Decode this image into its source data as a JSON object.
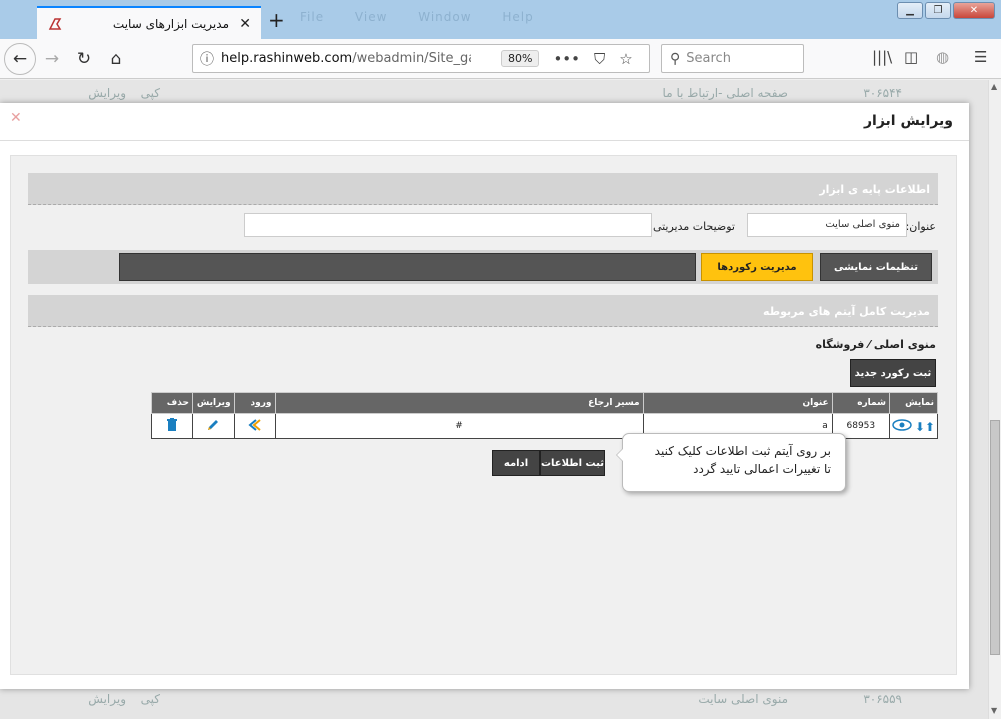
{
  "browser": {
    "tab_title": "مدیریت ابزارهای سایت",
    "tab_close": "✕",
    "new_tab": "+",
    "menu_ghost": [
      "File",
      "View",
      "Window",
      "Help"
    ],
    "url_host": "help.rashinweb.com",
    "url_path": "/webadmin/Site_gad",
    "zoom": "80%",
    "search_placeholder": "Search",
    "window_buttons": [
      "▁",
      "❐",
      "✕"
    ]
  },
  "background_rows": [
    {
      "id": "۳۰۶۵۴۴",
      "title": "صفحه اصلی -ارتباط با ما",
      "copy": "کپی",
      "edit": "ویرایش"
    },
    {
      "id": "۳۰۶۵۵۹",
      "title": "منوی اصلی سایت",
      "copy": "کپی",
      "edit": "ویرایش"
    }
  ],
  "modal": {
    "title": "ویرایش ابزار",
    "close": "✕",
    "base_info_header": "اطلاعات پایه ی ابزار",
    "title_label": "عنوان:",
    "title_value": "منوی اصلی سایت",
    "admin_desc_label": "توضیحات مدیریتی:",
    "admin_desc_value": "",
    "tabs": {
      "display_settings": "تنظیمات نمایشی",
      "record_management": "مدیریت رکوردها"
    },
    "items_header": "مدیریت کامل آیتم های مربوطه",
    "breadcrumb": "منوی اصلی ⁄ فروشگاه",
    "new_record_button": "ثبت رکورد جدید",
    "table": {
      "headers": [
        "نمایش",
        "شماره",
        "عنوان",
        "مسیر ارجاع",
        "ورود",
        "ویرایش",
        "حذف"
      ],
      "rows": [
        {
          "id": "68953",
          "title": "a",
          "path": "#"
        }
      ]
    },
    "submit_button": "ثبت اطلاعات",
    "continue_button": "ادامه",
    "tooltip_line1": "بر روی آیتم ثبت اطلاعات کلیک کنید",
    "tooltip_line2": "تا تغییرات اعمالی تایید گردد"
  }
}
